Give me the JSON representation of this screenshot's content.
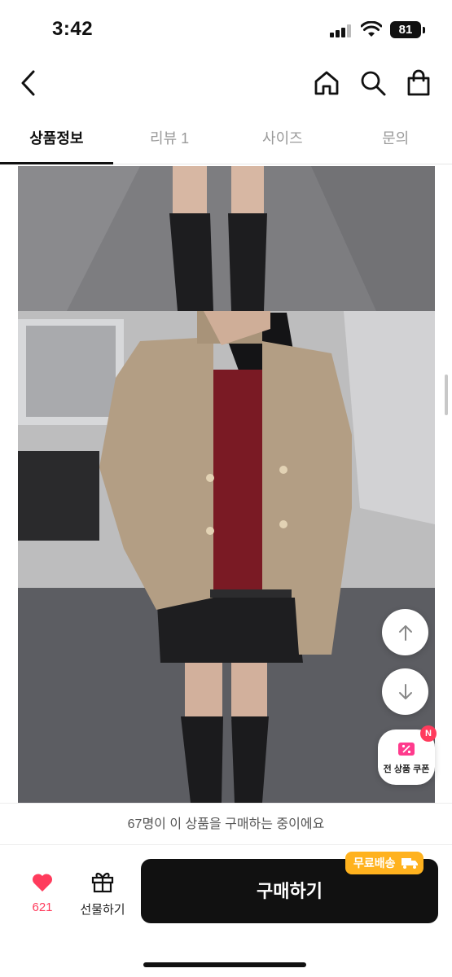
{
  "status_bar": {
    "time": "3:42",
    "battery": "81"
  },
  "header": {
    "back_icon": "chevron-left-icon",
    "home_icon": "home-icon",
    "search_icon": "search-icon",
    "bag_icon": "shopping-bag-icon"
  },
  "tabs": [
    {
      "label": "상품정보",
      "active": true
    },
    {
      "label": "리뷰 1",
      "active": false
    },
    {
      "label": "사이즈",
      "active": false
    },
    {
      "label": "문의",
      "active": false
    }
  ],
  "floating": {
    "scroll_up_icon": "arrow-up-icon",
    "scroll_down_icon": "arrow-down-icon",
    "coupon_label": "전 상품 쿠폰",
    "coupon_badge": "N"
  },
  "notice": {
    "text": "67명이 이 상품을 구매하는 중이에요"
  },
  "action_bar": {
    "like_count": "621",
    "gift_label": "선물하기",
    "buy_label": "구매하기",
    "shipping_badge": "무료배송"
  },
  "colors": {
    "accent_pink": "#ff3b5c",
    "shipping_orange": "#ffb21e",
    "buy_button": "#111111"
  }
}
